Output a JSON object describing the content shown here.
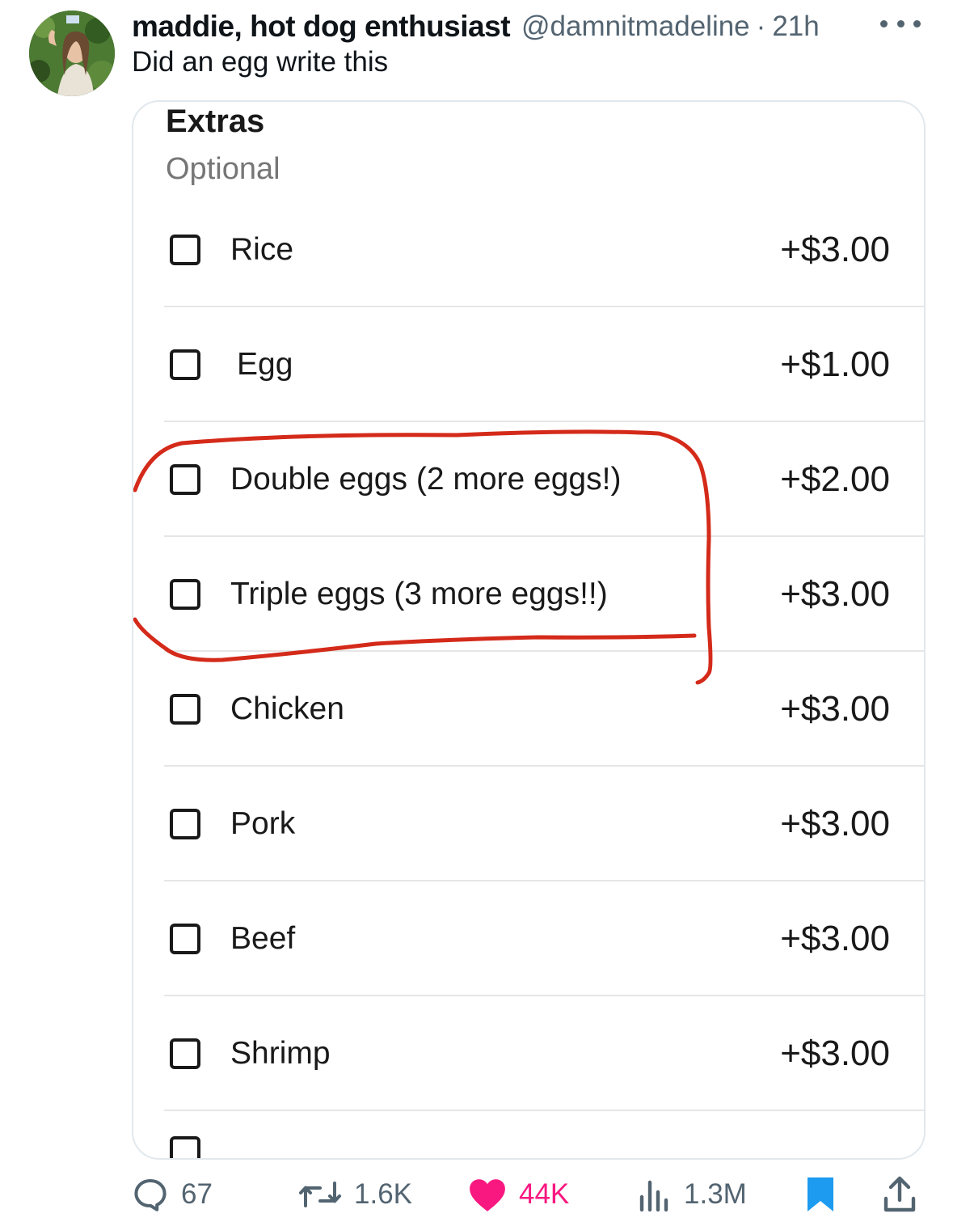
{
  "author": {
    "display_name": "maddie, hot dog enthusiast",
    "handle": "@damnitmadeline",
    "separator": "·",
    "time": "21h"
  },
  "tweet_text": "Did an egg write this",
  "media": {
    "section_title": "Extras",
    "section_subtitle": "Optional",
    "options": [
      {
        "label": "Rice",
        "price": "+$3.00",
        "checked": false
      },
      {
        "label": "Egg",
        "price": "+$1.00",
        "checked": false
      },
      {
        "label": "Double eggs (2 more eggs!)",
        "price": "+$2.00",
        "checked": false
      },
      {
        "label": "Triple eggs (3 more eggs!!)",
        "price": "+$3.00",
        "checked": false
      },
      {
        "label": "Chicken",
        "price": "+$3.00",
        "checked": false
      },
      {
        "label": "Pork",
        "price": "+$3.00",
        "checked": false
      },
      {
        "label": "Beef",
        "price": "+$3.00",
        "checked": false
      },
      {
        "label": "Shrimp",
        "price": "+$3.00",
        "checked": false
      }
    ],
    "annotation_color": "#d42a1a"
  },
  "actions": {
    "replies": "67",
    "reposts": "1.6K",
    "likes": "44K",
    "views": "1.3M"
  },
  "colors": {
    "text": "#0f1419",
    "muted": "#536471",
    "like": "#f91880",
    "bookmark": "#1d9bf0"
  },
  "icons": [
    "reply-icon",
    "repost-icon",
    "heart-icon",
    "views-icon",
    "bookmark-icon",
    "share-icon",
    "more-icon"
  ]
}
